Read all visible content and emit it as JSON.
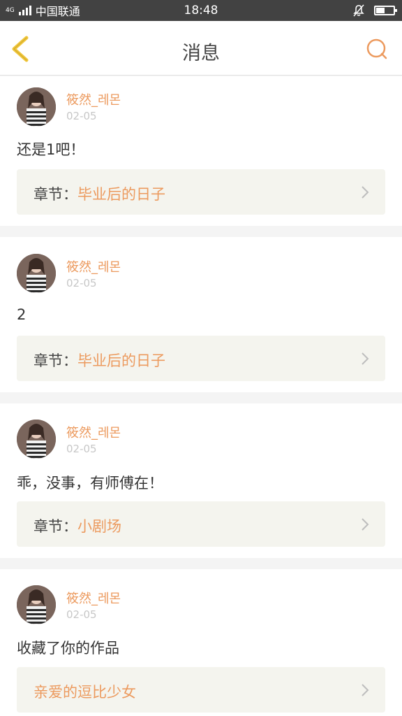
{
  "status_bar": {
    "network": "4G",
    "carrier": "中国联通",
    "time": "18:48"
  },
  "nav": {
    "title": "消息"
  },
  "colors": {
    "accent": "#ec9a5e",
    "back_icon": "#f0c63a",
    "text": "#333333",
    "muted": "#c7c7c7",
    "chapter_bg": "#f4f4ee"
  },
  "messages": [
    {
      "username": "筱然_레몬",
      "date": "02-05",
      "content": "还是1吧！",
      "chapter_prefix": "章节：",
      "chapter_title": "毕业后的日子"
    },
    {
      "username": "筱然_레몬",
      "date": "02-05",
      "content": "2",
      "chapter_prefix": "章节：",
      "chapter_title": "毕业后的日子"
    },
    {
      "username": "筱然_레몬",
      "date": "02-05",
      "content": "乖，没事，有师傅在！",
      "chapter_prefix": "章节：",
      "chapter_title": "小剧场"
    },
    {
      "username": "筱然_레몬",
      "date": "02-05",
      "content": "收藏了你的作品",
      "chapter_prefix": "",
      "chapter_title": "亲爱的逗比少女"
    }
  ]
}
